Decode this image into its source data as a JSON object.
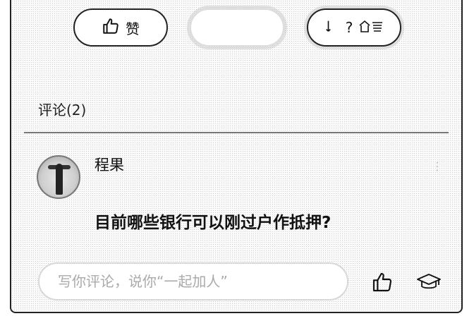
{
  "actions": {
    "like_label": "赞",
    "middle_label": "",
    "right_label": "?"
  },
  "comments": {
    "title": "评论(2)",
    "items": [
      {
        "name": "程果",
        "meta": "",
        "text": "目前哪些银行可以刚过户作抵押?"
      }
    ]
  },
  "composer": {
    "placeholder": "写你评论，说你“一起加人”"
  },
  "icons": {
    "like": "thumbs-up-icon",
    "cap": "graduation-cap-icon"
  }
}
